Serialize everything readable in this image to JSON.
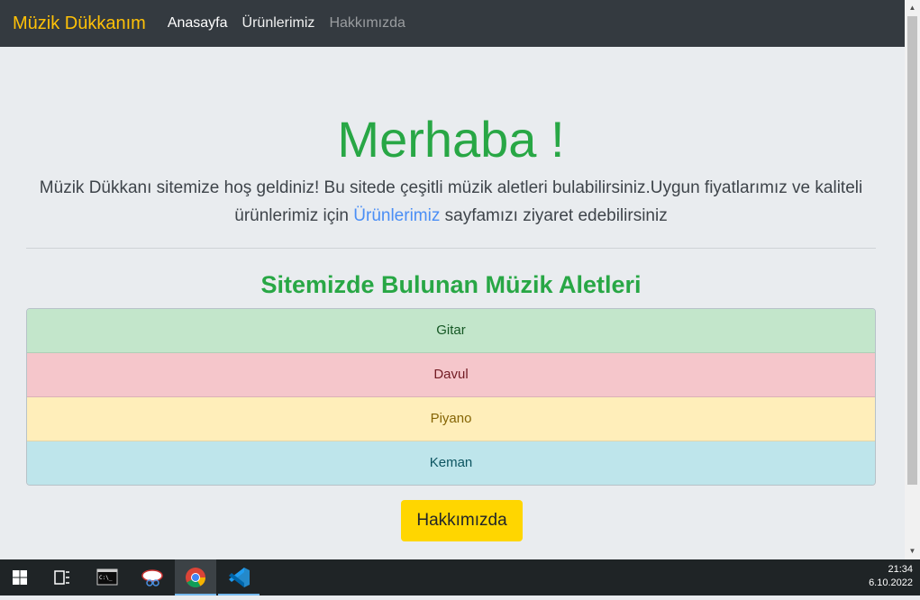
{
  "navbar": {
    "brand": "Müzik Dükkanım",
    "links": [
      "Anasayfa",
      "Ürünlerimiz",
      "Hakkımızda"
    ]
  },
  "hero": {
    "title": "Merhaba !",
    "text_before_link": "Müzik Dükkanı sitemize hoş geldiniz! Bu sitede çeşitli müzik aletleri bulabilirsiniz.Uygun fiyatlarımız ve kaliteli ürünlerimiz için ",
    "link": "Ürünlerimiz",
    "text_after_link": " sayfamızı ziyaret edebilirsiniz"
  },
  "section": {
    "title": "Sitemizde Bulunan Müzik Aletleri",
    "items": [
      {
        "label": "Gitar",
        "bg": "#c3e6cb",
        "color": "#155724"
      },
      {
        "label": "Davul",
        "bg": "#f5c6cb",
        "color": "#721c24"
      },
      {
        "label": "Piyano",
        "bg": "#ffeeba",
        "color": "#856404"
      },
      {
        "label": "Keman",
        "bg": "#bee5eb",
        "color": "#0c5460"
      }
    ]
  },
  "button": {
    "label": "Hakkımızda"
  },
  "taskbar": {
    "icons": [
      "windows-start-icon",
      "task-view-icon",
      "terminal-icon",
      "snipping-tool-icon",
      "chrome-icon",
      "vscode-icon"
    ],
    "time": "21:34",
    "date": "6.10.2022"
  },
  "colors": {
    "accent_green": "#28a745",
    "brand_yellow": "#ffc107",
    "button_yellow": "#ffd600",
    "navbar_bg": "#343a40",
    "link_blue": "#4a8ef5"
  }
}
